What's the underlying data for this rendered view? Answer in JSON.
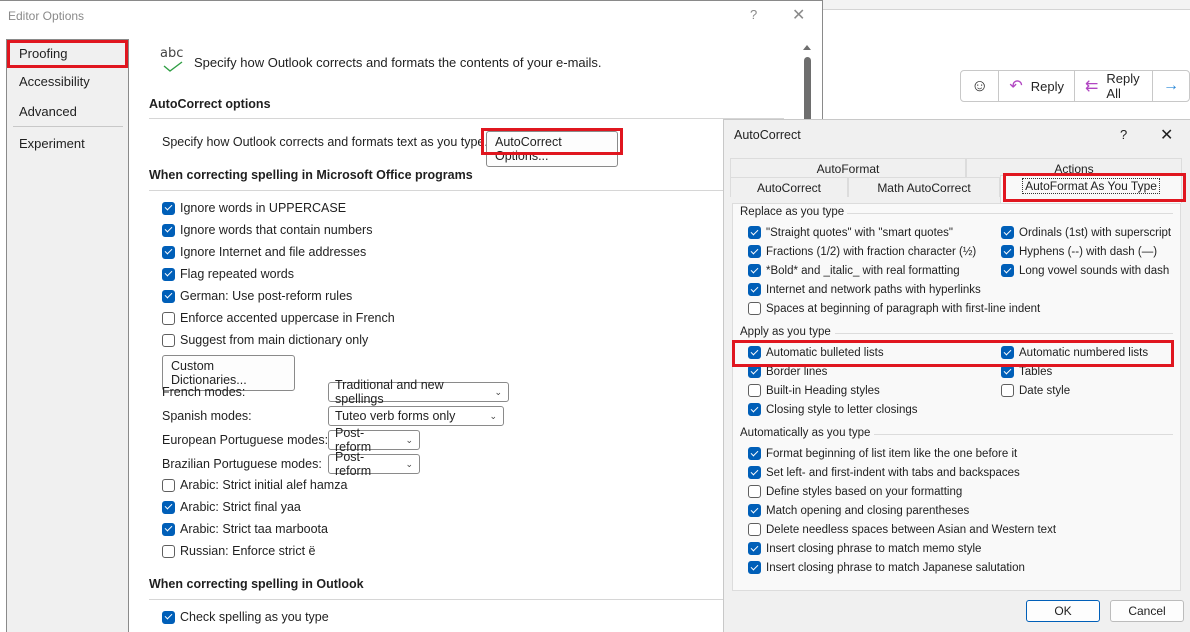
{
  "editor": {
    "title": "Editor Options",
    "help": "?",
    "close": "✕",
    "nav": [
      {
        "label": "Proofing",
        "selected": true
      },
      {
        "label": "Accessibility"
      },
      {
        "label": "Advanced"
      },
      {
        "label": "Experiment"
      }
    ],
    "intro": "Specify how Outlook corrects and formats the contents of your e-mails.",
    "abc_icon_text": "abc",
    "autocorrect_section": {
      "title": "AutoCorrect options",
      "desc": "Specify how Outlook corrects and formats text as you type.",
      "button": "AutoCorrect Options..."
    },
    "office_section": {
      "title": "When correcting spelling in Microsoft Office programs",
      "checks": [
        {
          "label": "Ignore words in UPPERCASE",
          "checked": true
        },
        {
          "label": "Ignore words that contain numbers",
          "checked": true
        },
        {
          "label": "Ignore Internet and file addresses",
          "checked": true
        },
        {
          "label": "Flag repeated words",
          "checked": true
        },
        {
          "label": "German: Use post-reform rules",
          "checked": true
        },
        {
          "label": "Enforce accented uppercase in French",
          "checked": false
        },
        {
          "label": "Suggest from main dictionary only",
          "checked": false
        }
      ],
      "custom_dict_button": "Custom Dictionaries...",
      "modes": [
        {
          "label": "French modes:",
          "value": "Traditional and new spellings"
        },
        {
          "label": "Spanish modes:",
          "value": "Tuteo verb forms only"
        },
        {
          "label": "European Portuguese modes:",
          "value": "Post-reform"
        },
        {
          "label": "Brazilian Portuguese modes:",
          "value": "Post-reform"
        }
      ],
      "checks2": [
        {
          "label": "Arabic: Strict initial alef hamza",
          "checked": false
        },
        {
          "label": "Arabic: Strict final yaa",
          "checked": true
        },
        {
          "label": "Arabic: Strict taa marboota",
          "checked": true
        },
        {
          "label": "Russian: Enforce strict ë",
          "checked": false
        }
      ]
    },
    "outlook_section": {
      "title": "When correcting spelling in Outlook",
      "checks": [
        {
          "label": "Check spelling as you type",
          "checked": true
        }
      ]
    }
  },
  "background": {
    "reply_bar": {
      "emoji_icon": "☺",
      "reply": "Reply",
      "reply_all": "Reply All",
      "forward_icon": "→"
    }
  },
  "autocorrect": {
    "title": "AutoCorrect",
    "help": "?",
    "close": "✕",
    "tabs_top": [
      "AutoFormat",
      "Actions"
    ],
    "tabs_bottom": [
      "AutoCorrect",
      "Math AutoCorrect",
      "AutoFormat As You Type"
    ],
    "active_tab": "AutoFormat As You Type",
    "replace": {
      "title": "Replace as you type",
      "left": [
        {
          "label": "\"Straight quotes\" with \"smart quotes\"",
          "checked": true
        },
        {
          "label": "Fractions (1/2) with fraction character (½)",
          "checked": true
        },
        {
          "label": "*Bold* and _italic_ with real formatting",
          "checked": true
        },
        {
          "label": "Internet and network paths with hyperlinks",
          "checked": true
        },
        {
          "label": "Spaces at beginning of paragraph with first-line indent",
          "checked": false
        }
      ],
      "right": [
        {
          "label": "Ordinals (1st) with superscript",
          "checked": true
        },
        {
          "label": "Hyphens (--) with dash (—)",
          "checked": true
        },
        {
          "label": "Long vowel sounds with dash",
          "checked": true
        }
      ]
    },
    "apply": {
      "title": "Apply as you type",
      "left": [
        {
          "label": "Automatic bulleted lists",
          "checked": true
        },
        {
          "label": "Border lines",
          "checked": true
        },
        {
          "label": "Built-in Heading styles",
          "checked": false
        },
        {
          "label": "Closing style to letter closings",
          "checked": true
        }
      ],
      "right": [
        {
          "label": "Automatic numbered lists",
          "checked": true
        },
        {
          "label": "Tables",
          "checked": true
        },
        {
          "label": "Date style",
          "checked": false
        }
      ]
    },
    "auto": {
      "title": "Automatically as you type",
      "items": [
        {
          "label": "Format beginning of list item like the one before it",
          "checked": true
        },
        {
          "label": "Set left- and first-indent with tabs and backspaces",
          "checked": true
        },
        {
          "label": "Define styles based on your formatting",
          "checked": false
        },
        {
          "label": "Match opening and closing parentheses",
          "checked": true
        },
        {
          "label": "Delete needless spaces between Asian and Western text",
          "checked": false
        },
        {
          "label": "Insert closing phrase to match memo style",
          "checked": true
        },
        {
          "label": "Insert closing phrase to match Japanese salutation",
          "checked": true
        }
      ]
    },
    "ok": "OK",
    "cancel": "Cancel"
  },
  "colors": {
    "accent": "#005fb8",
    "highlight": "#e0161f"
  }
}
